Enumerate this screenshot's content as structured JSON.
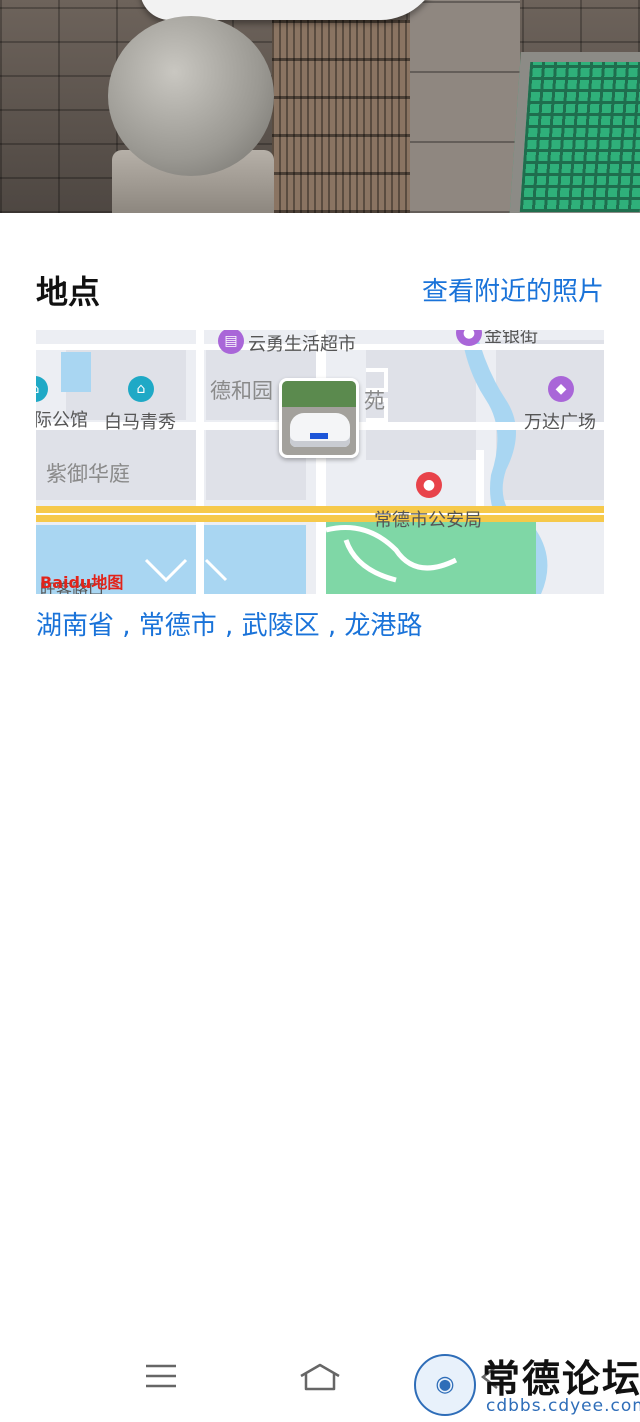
{
  "section": {
    "title": "地点",
    "nearby_link": "查看附近的照片"
  },
  "map": {
    "labels": {
      "yunyong": "云勇生活超市",
      "jinyin": "金银街",
      "dehe": "德和园",
      "yuan": "苑",
      "baima": "白马青秀",
      "gongguan": "际公馆",
      "wanda": "万达广场",
      "ziyu": "紫御华庭",
      "police": "常德市公安局",
      "road": "旺客路口"
    },
    "logo": "Baidu地图",
    "colors": {
      "road_main": "#f6c94a",
      "park": "#7fd7a6",
      "water": "#a9d6f2",
      "link": "#1a73d9"
    }
  },
  "address": "湖南省 , 常德市 , 武陵区 , 龙港路",
  "nav": {
    "menu_icon": "menu-icon",
    "home_icon": "home-icon",
    "back_icon": "back-icon"
  },
  "watermark": {
    "title": "常德论坛",
    "subtitle": "cdbbs.cdyee.com"
  }
}
